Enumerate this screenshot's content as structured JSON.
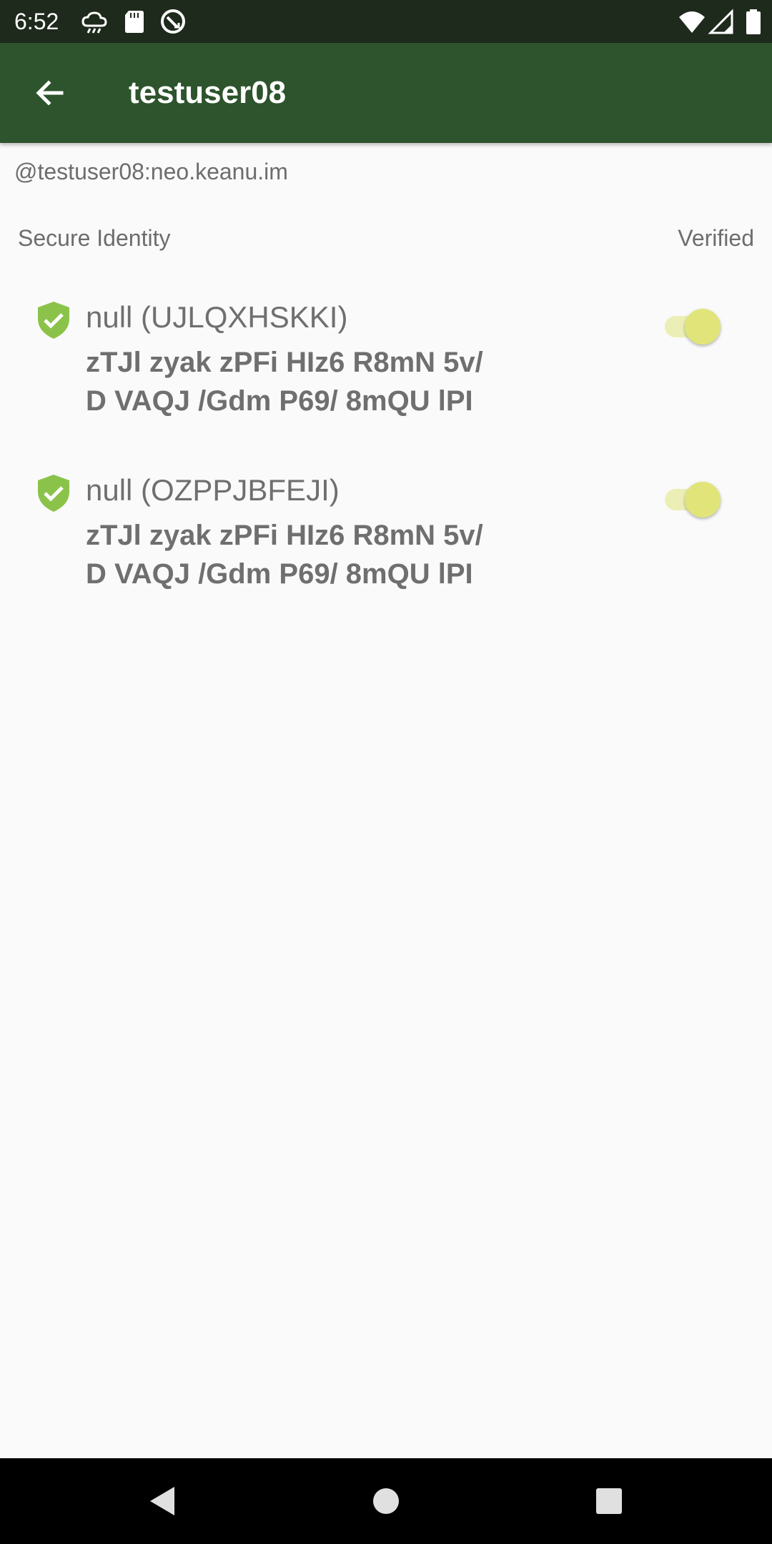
{
  "status_bar": {
    "time": "6:52",
    "left_icons": [
      "cloud-icon",
      "sd-card-icon",
      "sync-icon"
    ],
    "right_icons": [
      "wifi-icon",
      "signal-icon",
      "battery-icon"
    ]
  },
  "app_bar": {
    "title": "testuser08",
    "back_icon": "arrow-back-icon"
  },
  "user_id": "@testuser08:neo.keanu.im",
  "section": {
    "label": "Secure Identity",
    "right_label": "Verified"
  },
  "devices": [
    {
      "name": "null (UJLQXHSKKI)",
      "fingerprint_line1": "zTJl zyak zPFi HIz6 R8mN 5v/",
      "fingerprint_line2": "D VAQJ /Gdm P69/ 8mQU lPI",
      "verified": true
    },
    {
      "name": "null (OZPPJBFEJI)",
      "fingerprint_line1": "zTJl zyak zPFi HIz6 R8mN 5v/",
      "fingerprint_line2": "D VAQJ /Gdm P69/ 8mQU lPI",
      "verified": true
    }
  ],
  "colors": {
    "status_bar": "#1e2a1b",
    "app_bar": "#2d542c",
    "shield": "#8bc34a",
    "toggle_thumb": "#e1e579",
    "toggle_track": "#ecefb5"
  },
  "nav_bar": {
    "buttons": [
      "back-triangle-icon",
      "home-circle-icon",
      "recents-square-icon"
    ]
  }
}
